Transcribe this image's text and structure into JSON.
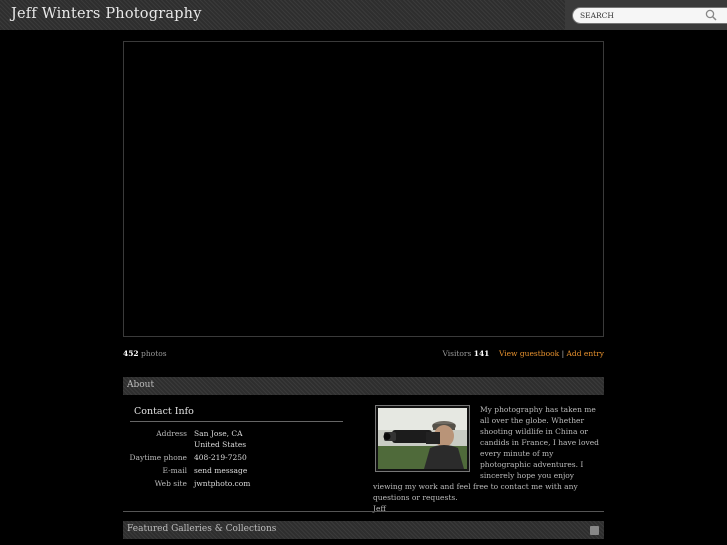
{
  "header": {
    "site_title": "Jeff Winters Photography",
    "search_placeholder": "SEARCH"
  },
  "stats": {
    "photo_count": "452",
    "photos_label": "photos",
    "visitors_label": "Visitors",
    "visitors_count": "141",
    "view_guestbook": "View guestbook",
    "separator": "|",
    "add_entry": "Add entry"
  },
  "about": {
    "section_title": "About",
    "contact_heading": "Contact Info",
    "contact": [
      {
        "label": "Address",
        "value": "San Jose, CA"
      },
      {
        "label": "",
        "value": "United States"
      },
      {
        "label": "Daytime phone",
        "value": "408-219-7250"
      },
      {
        "label": "E-mail",
        "value": "send message"
      },
      {
        "label": "Web site",
        "value": "jwntphoto.com"
      }
    ],
    "bio": "My photography has taken me all over the globe. Whether shooting wildlife in China or candids in France, I have loved every minute of my photographic adventures. I sincerely hope you enjoy viewing my work and feel free to contact me with any questions or requests.",
    "signature": "Jeff"
  },
  "featured": {
    "section_title": "Featured Galleries & Collections"
  },
  "colors": {
    "accent": "#e8922e",
    "background": "#000000",
    "bar": "#2e2e2e"
  }
}
